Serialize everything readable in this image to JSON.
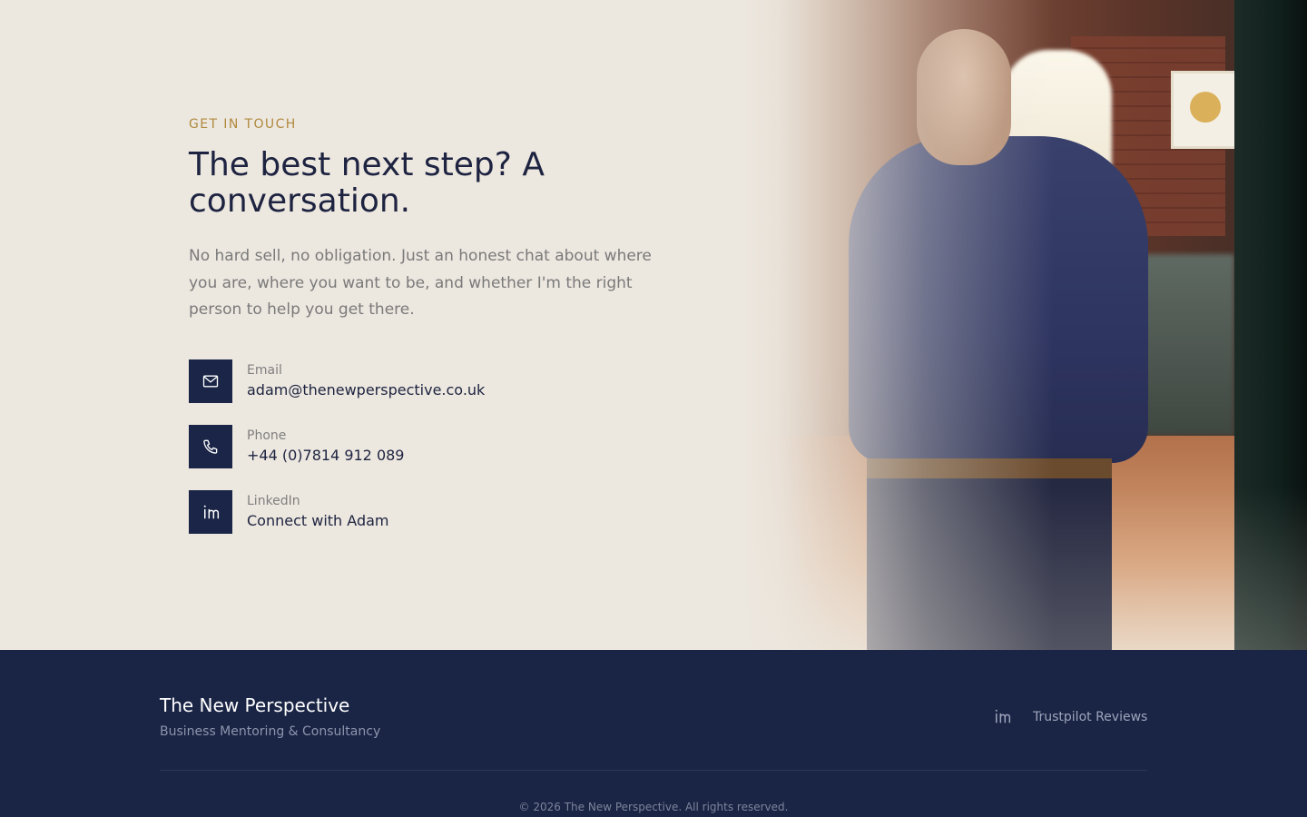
{
  "contact": {
    "eyebrow": "GET IN TOUCH",
    "headline": "The best next step? A conversation.",
    "intro": "No hard sell, no obligation. Just an honest chat about where you are, where you want to be, and whether I'm the right person to help you get there.",
    "items": [
      {
        "label": "Email",
        "value": "adam@thenewperspective.co.uk",
        "icon": "mail-icon"
      },
      {
        "label": "Phone",
        "value": "+44 (0)7814 912 089",
        "icon": "phone-icon"
      },
      {
        "label": "LinkedIn",
        "value": "Connect with Adam",
        "icon": "linkedin-icon"
      }
    ]
  },
  "footer": {
    "brand_name": "The New Perspective",
    "brand_tagline": "Business Mentoring & Consultancy",
    "linkedin_icon": "linkedin-icon",
    "trustpilot_label": "Trustpilot Reviews",
    "copyright": "© 2026 The New Perspective. All rights reserved."
  },
  "colors": {
    "background": "#ece7df",
    "navy": "#1a2545",
    "accent_gold": "#b08a3e",
    "heading": "#1d2340"
  }
}
